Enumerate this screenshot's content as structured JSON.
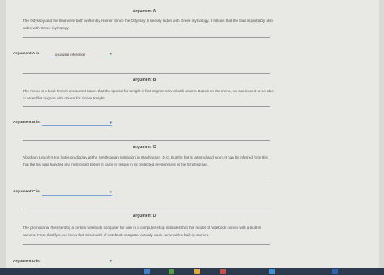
{
  "arguments": [
    {
      "title": "Argument A",
      "text": "The Odyssey and the Iliad were both written by Homer. Since the Odyssey is heavily laden with Greek mythology, it follows that the Iliad is probably also laden with Greek mythology.",
      "answer_label": "Argument A is",
      "selected": "a causal inference"
    },
    {
      "title": "Argument B",
      "text": "The menu at a local French restaurant states that the special for tonight is filet mignon served with onions. Based on the menu, we can expect to be able to order filet mignon with onions for dinner tonight.",
      "answer_label": "Argument B is",
      "selected": ""
    },
    {
      "title": "Argument C",
      "text": "Abraham Lincoln's top hat is on display at the Smithsonian Institution in Washington, D.C. But the hat is tattered and worn. It can be inferred from this that the hat was handled and mistreated before it came to reside in its protected environment at the Smithsonian.",
      "answer_label": "Argument C is",
      "selected": ""
    },
    {
      "title": "Argument D",
      "text": "The promotional flyer sent by a certain notebook computer for sale in a computer shop indicates that this model of notebook comes with a built-in camera. From this flyer, we know that this model of notebook computer actually does come with a built-in camera.",
      "answer_label": "Argument D is",
      "selected": ""
    }
  ],
  "taskbar": {
    "icons": [
      "file-explorer-icon",
      "photos-icon",
      "folder-icon",
      "app-icon",
      "browser-icon",
      "word-icon"
    ],
    "colors": [
      "#3c7fd1",
      "#5a9b4a",
      "#e0a93a",
      "#c94f4f",
      "#3a8fd6",
      "#2b64b5"
    ]
  }
}
